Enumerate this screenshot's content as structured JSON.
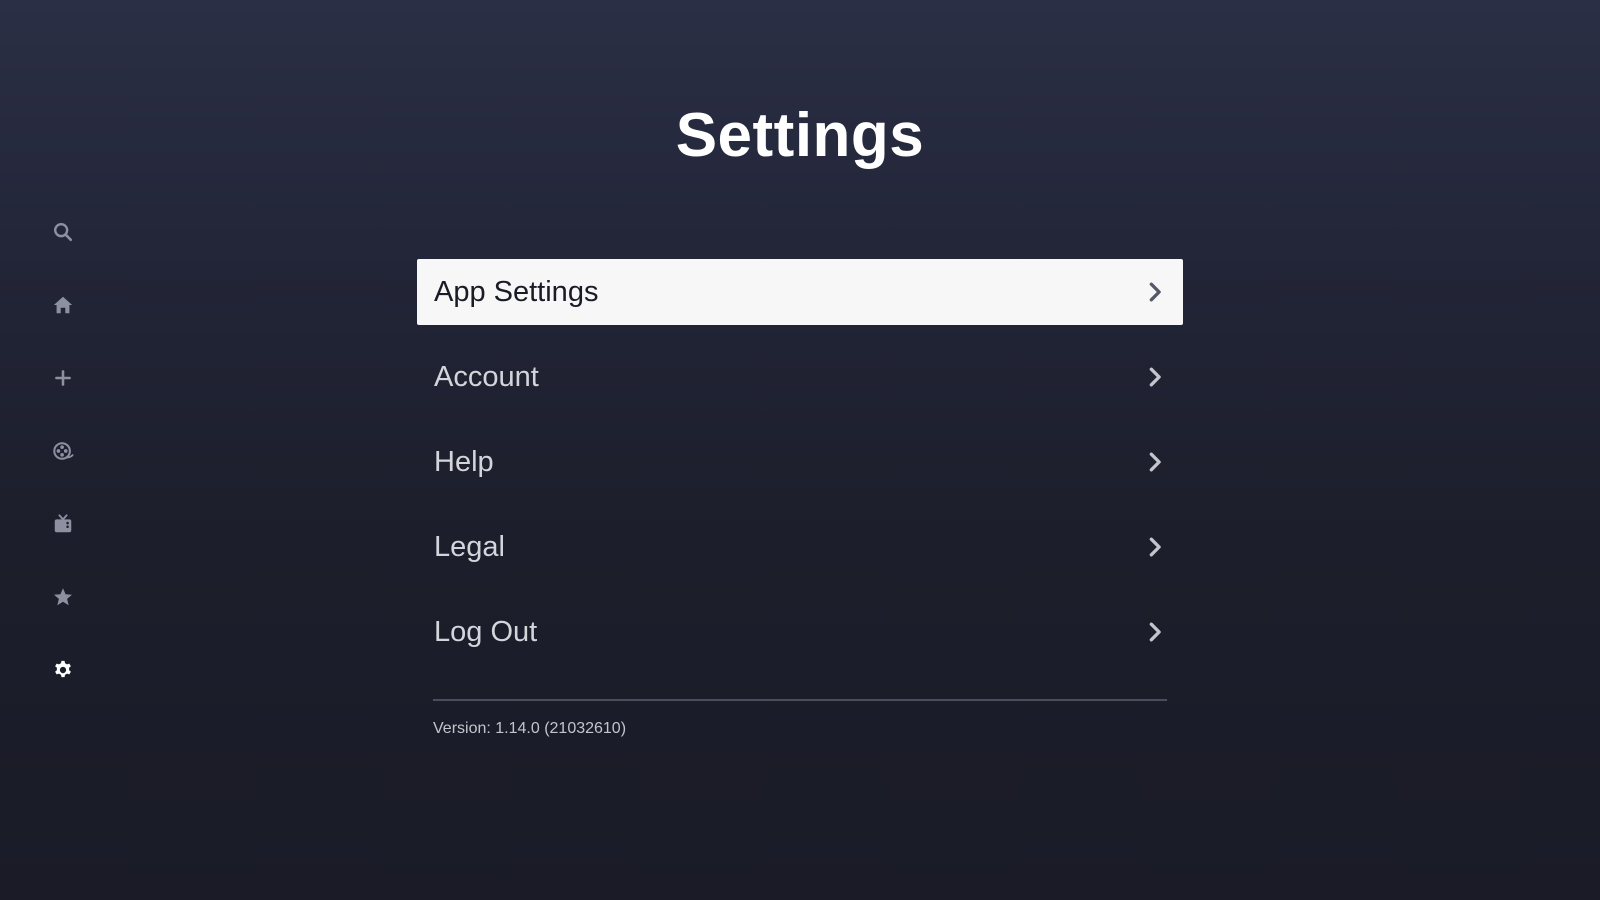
{
  "page": {
    "title": "Settings"
  },
  "sidebar": {
    "items": [
      {
        "icon": "search-icon",
        "active": false
      },
      {
        "icon": "home-icon",
        "active": false
      },
      {
        "icon": "plus-icon",
        "active": false
      },
      {
        "icon": "movies-icon",
        "active": false
      },
      {
        "icon": "tv-icon",
        "active": false
      },
      {
        "icon": "star-icon",
        "active": false
      },
      {
        "icon": "gear-icon",
        "active": true
      }
    ]
  },
  "menu": {
    "items": [
      {
        "label": "App Settings",
        "selected": true
      },
      {
        "label": "Account",
        "selected": false
      },
      {
        "label": "Help",
        "selected": false
      },
      {
        "label": "Legal",
        "selected": false
      },
      {
        "label": "Log Out",
        "selected": false
      }
    ]
  },
  "footer": {
    "version": "Version: 1.14.0 (21032610)"
  },
  "colors": {
    "background_top": "#2b2f45",
    "background_bottom": "#1a1b27",
    "selected_row": "#f7f7f7",
    "icon_inactive": "#8d90a0",
    "icon_active": "#ffffff"
  }
}
